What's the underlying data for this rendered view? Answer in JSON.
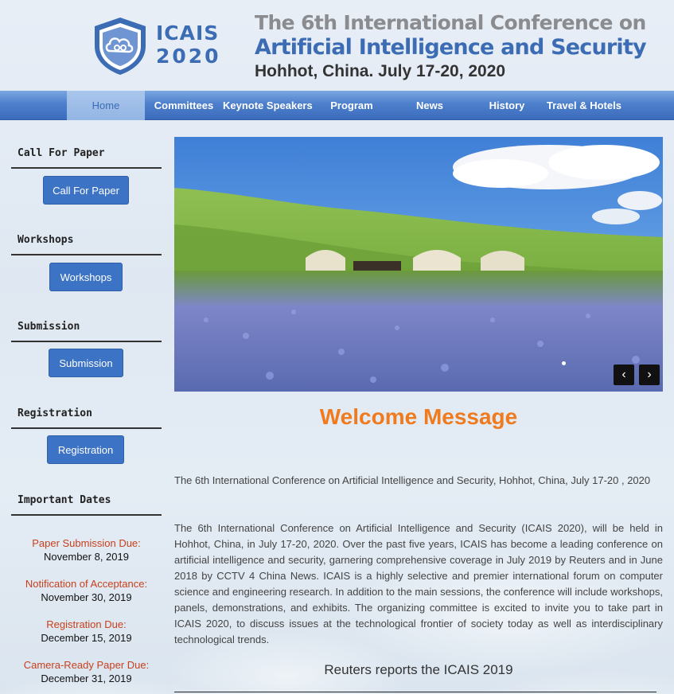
{
  "header": {
    "logo_name": "ICAIS",
    "logo_year": "2020",
    "title_line1": "The 6th International Conference on",
    "title_line2": "Artificial Intelligence and Security",
    "title_line3": "Hohhot, China.   July 17-20, 2020"
  },
  "nav": {
    "items": [
      {
        "label": "Home",
        "active": true
      },
      {
        "label": "Committees"
      },
      {
        "label": "Keynote Speakers"
      },
      {
        "label": "Program"
      },
      {
        "label": "News"
      },
      {
        "label": "History"
      },
      {
        "label": "Travel & Hotels"
      }
    ]
  },
  "sidebar": {
    "sections": [
      {
        "heading": "Call For Paper",
        "button": "Call For Paper"
      },
      {
        "heading": "Workshops",
        "button": "Workshops"
      },
      {
        "heading": "Submission",
        "button": "Submission"
      },
      {
        "heading": "Registration",
        "button": "Registration"
      }
    ],
    "dates_heading": "Important Dates",
    "dates": [
      {
        "label": "Paper Submission Due:",
        "value": "November 8, 2019"
      },
      {
        "label": "Notification of Acceptance:",
        "value": "November 30, 2019"
      },
      {
        "label": "Registration Due:",
        "value": "December 15, 2019"
      },
      {
        "label": "Camera-Ready Paper Due:",
        "value": "December 31, 2019"
      }
    ]
  },
  "carousel": {
    "prev_icon": "chevron-left-icon",
    "next_icon": "chevron-right-icon",
    "prev_glyph": "‹",
    "next_glyph": "›"
  },
  "main": {
    "welcome_title": "Welcome Message",
    "intro": "The 6th International Conference on Artificial Intelligence and Security, Hohhot, China, July 17-20 , 2020",
    "paragraph": "The 6th International Conference on Artificial Intelligence and Security (ICAIS 2020), will be held in Hohhot, China, in July 17-20, 2020. Over the past five years, ICAIS has become a leading conference on artificial intelligence and security, garnering comprehensive coverage in July 2019 by Reuters and in June 2018 by CCTV 4 China News. ICAIS is a highly selective and premier international forum on computer science and engineering research. In addition to the main sessions, the conference will include workshops, panels, demonstrations, and exhibits. The organizing committee is excited to invite you to take part in ICAIS 2020, to discuss issues at the technological frontier of society today as well as interdisciplinary technological trends.",
    "reuters_heading": "Reuters reports the ICAIS 2019"
  },
  "colors": {
    "brand_blue": "#3b6cb4",
    "accent_orange": "#f07a1e",
    "date_red": "#c8401c"
  }
}
